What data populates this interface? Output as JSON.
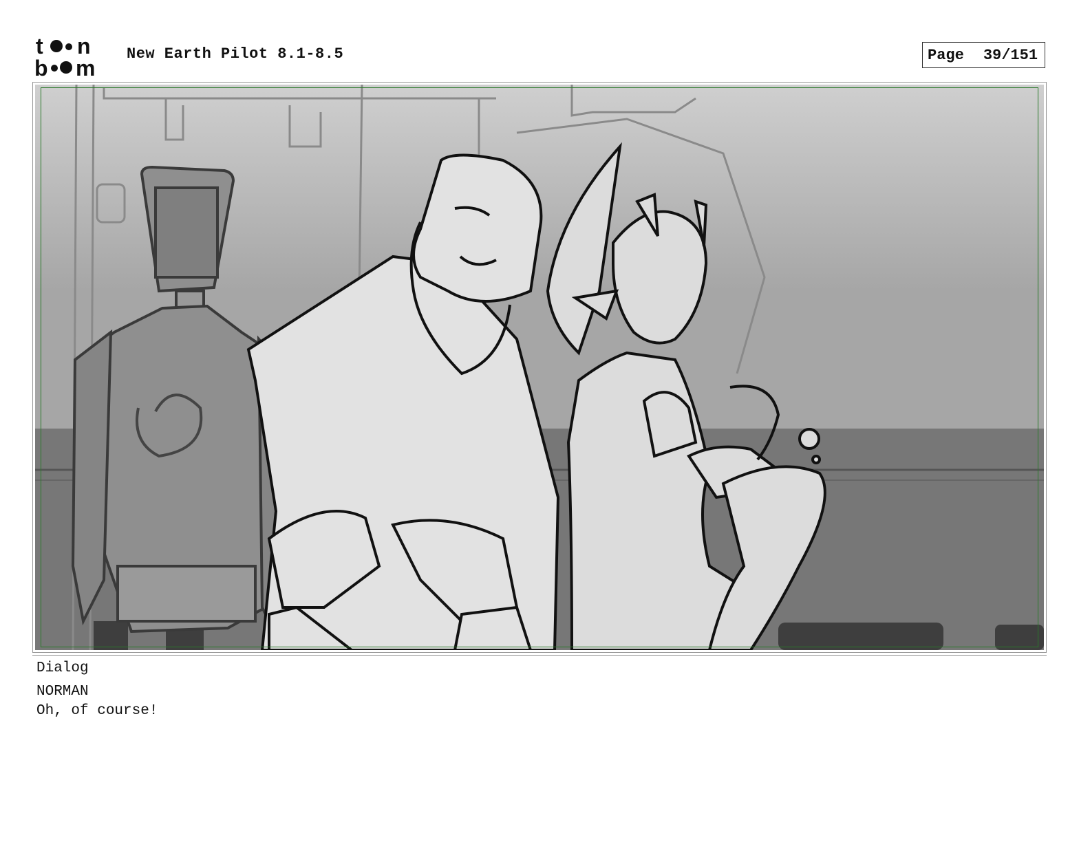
{
  "logo": {
    "line1": "toon",
    "line2": "boom"
  },
  "header": {
    "title": "New Earth Pilot 8.1-8.5",
    "page_label": "Page",
    "page_number": "39/151"
  },
  "panel": {
    "image_description_icon": "storyboard-sketch",
    "colors": {
      "frame": "#2a7a2a",
      "sketch_bg_top": "#c8c8c8",
      "sketch_bg_bottom": "#6e6e6e"
    }
  },
  "dialog": {
    "label": "Dialog",
    "speaker": "NORMAN",
    "line": "Oh, of course!"
  }
}
